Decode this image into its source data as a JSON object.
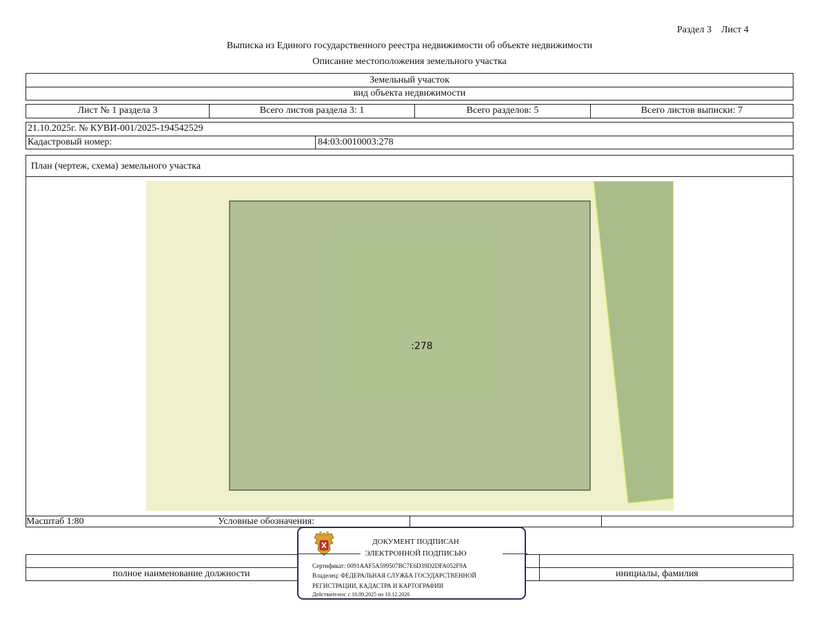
{
  "header": {
    "section_sheet": "Раздел 3    Лист 4",
    "title": "Выписка из Единого государственного реестра недвижимости об объекте недвижимости",
    "subtitle": "Описание местоположения земельного участка"
  },
  "object": {
    "type": "Земельный участок",
    "type_caption": "вид объекта недвижимости"
  },
  "sheet_info": {
    "sheet_no": "Лист № 1 раздела 3",
    "section_sheets": "Всего листов раздела 3: 1",
    "total_sections": "Всего разделов: 5",
    "total_sheets": "Всего листов выписки: 7"
  },
  "record": {
    "date_number": "21.10.2025г. № КУВИ-001/2025-194542529",
    "cadastral_label": "Кадастровый номер:",
    "cadastral_value": "84:03:0010003:278"
  },
  "plan": {
    "title": "План (чертеж, схема) земельного участка",
    "parcel_label": ":278",
    "colors": {
      "background": "#f0f0cc",
      "parcel": "#b1c195",
      "neighbor": "#a8bd8a",
      "neighbor_edge": "#d9ea6a"
    }
  },
  "legend_row": {
    "scale": "Масштаб 1:80",
    "legend_label": "Условные обозначения:"
  },
  "signature": {
    "position_caption": "полное наименование должности",
    "name_caption": "инициалы, фамилия"
  },
  "stamp": {
    "icon": "eagle-emblem-icon",
    "line1": "ДОКУМЕНТ ПОДПИСАН",
    "line2": "ЭЛЕКТРОННОЙ ПОДПИСЬЮ",
    "certificate": "Сертификат: 0091AAF5A599507BC7E6D39D2DFA052F9A",
    "owner1": "Владелец: ФЕДЕРАЛЬНАЯ СЛУЖБА ГОСУДАРСТВЕННОЙ",
    "owner2": "РЕГИСТРАЦИИ, КАДАСТРА И КАРТОГРАФИИ",
    "valid": "Действителен: с 16.09.2025 по 10.12.2026",
    "border_color": "#2a2f57"
  }
}
